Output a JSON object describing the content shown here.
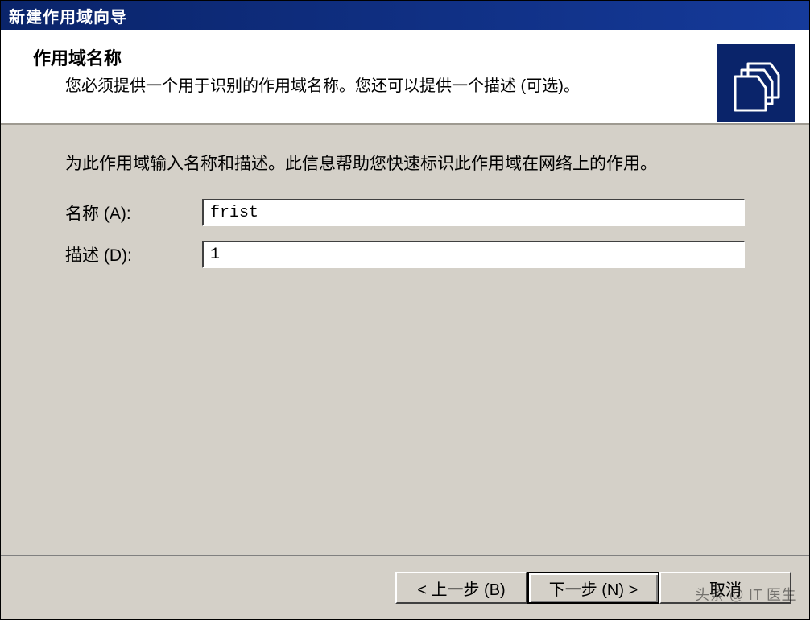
{
  "window": {
    "title": "新建作用域向导"
  },
  "header": {
    "title": "作用域名称",
    "subtitle": "您必须提供一个用于识别的作用域名称。您还可以提供一个描述 (可选)。",
    "icon": "folders-icon"
  },
  "body": {
    "description": "为此作用域输入名称和描述。此信息帮助您快速标识此作用域在网络上的作用。",
    "fields": {
      "name": {
        "label": "名称 (A):",
        "value": "frist"
      },
      "desc": {
        "label": "描述 (D):",
        "value": "1"
      }
    }
  },
  "footer": {
    "back": "< 上一步 (B)",
    "next": "下一步 (N) >",
    "cancel": "取消"
  },
  "watermark": "头条 @ IT 医生"
}
